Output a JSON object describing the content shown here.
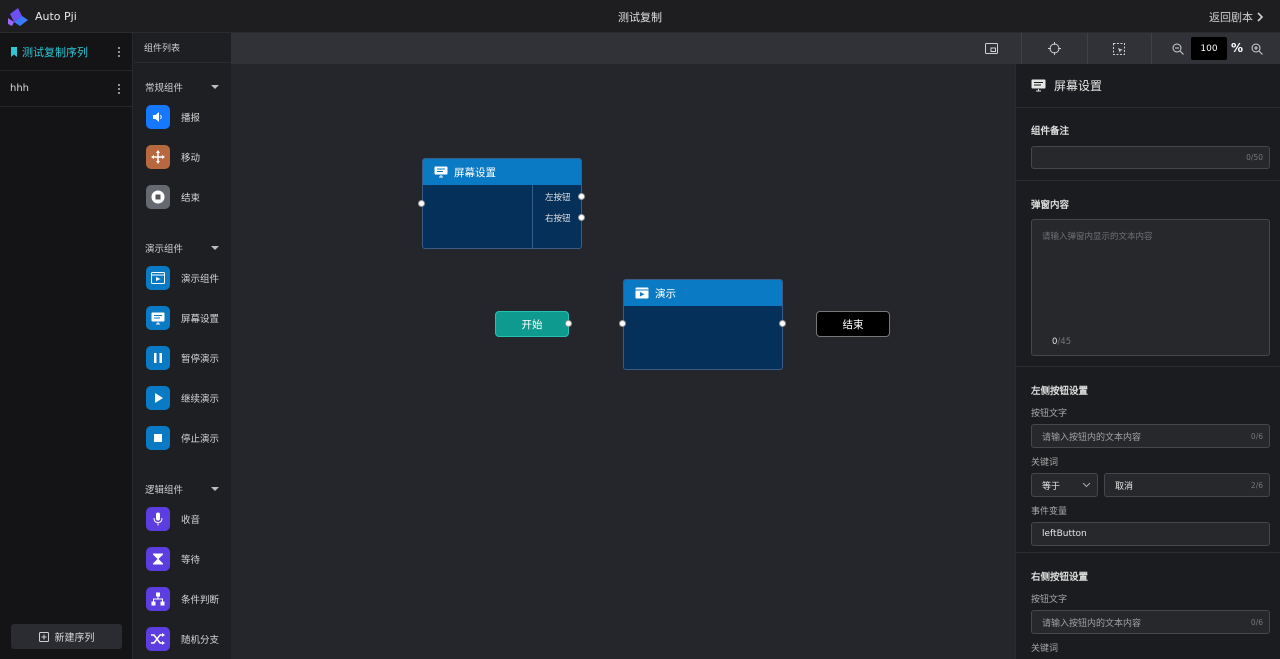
{
  "app": {
    "logo_text": "Auto Pji",
    "title": "测试复制",
    "back_label": "返回剧本"
  },
  "sequence_panel": {
    "title": "测试复制序列",
    "items": [
      {
        "label": "hhh"
      }
    ],
    "new_button": "新建序列"
  },
  "component_panel": {
    "header": "组件列表",
    "groups": [
      {
        "title": "常规组件",
        "items": [
          {
            "label": "播报",
            "icon": "speaker-icon",
            "color": "#1677ff"
          },
          {
            "label": "移动",
            "icon": "move-icon",
            "color": "#b8683e"
          },
          {
            "label": "结束",
            "icon": "stop-circle-icon",
            "color": "#666a70"
          }
        ]
      },
      {
        "title": "演示组件",
        "items": [
          {
            "label": "演示组件",
            "icon": "presentation-icon",
            "color": "#0b7ac4"
          },
          {
            "label": "屏幕设置",
            "icon": "screen-icon",
            "color": "#0b7ac4"
          },
          {
            "label": "暂停演示",
            "icon": "pause-icon",
            "color": "#0b7ac4"
          },
          {
            "label": "继续演示",
            "icon": "play-icon",
            "color": "#0b7ac4"
          },
          {
            "label": "停止演示",
            "icon": "stop-icon",
            "color": "#0b7ac4"
          }
        ]
      },
      {
        "title": "逻辑组件",
        "items": [
          {
            "label": "收音",
            "icon": "microphone-icon",
            "color": "#5b3de0"
          },
          {
            "label": "等待",
            "icon": "hourglass-icon",
            "color": "#5b3de0"
          },
          {
            "label": "条件判断",
            "icon": "branch-icon",
            "color": "#5b3de0"
          },
          {
            "label": "随机分支",
            "icon": "shuffle-icon",
            "color": "#5b3de0"
          }
        ]
      }
    ]
  },
  "toolbar": {
    "zoom_value": "100",
    "zoom_unit": "%"
  },
  "canvas": {
    "screen_node": {
      "title": "屏幕设置",
      "left_button": "左按钮",
      "right_button": "右按钮"
    },
    "demo_node": {
      "title": "演示"
    },
    "start_node": "开始",
    "end_node": "结束"
  },
  "properties": {
    "title": "屏幕设置",
    "note": {
      "label": "组件备注",
      "counter": "0/50"
    },
    "popup": {
      "label": "弹窗内容",
      "placeholder": "请输入弹窗内显示的文本内容",
      "count": "0",
      "max": "/45"
    },
    "left": {
      "section": "左侧按钮设置",
      "button_text_label": "按钮文字",
      "button_text_placeholder": "请输入按钮内的文本内容",
      "button_text_counter": "0/6",
      "keyword_label": "关键词",
      "operator": "等于",
      "keyword_value": "取消",
      "keyword_counter": "2/6",
      "event_label": "事件变量",
      "event_value": "leftButton"
    },
    "right": {
      "section": "右侧按钮设置",
      "button_text_label": "按钮文字",
      "button_text_placeholder": "请输入按钮内的文本内容",
      "button_text_counter": "0/6",
      "keyword_label": "关键词"
    }
  }
}
